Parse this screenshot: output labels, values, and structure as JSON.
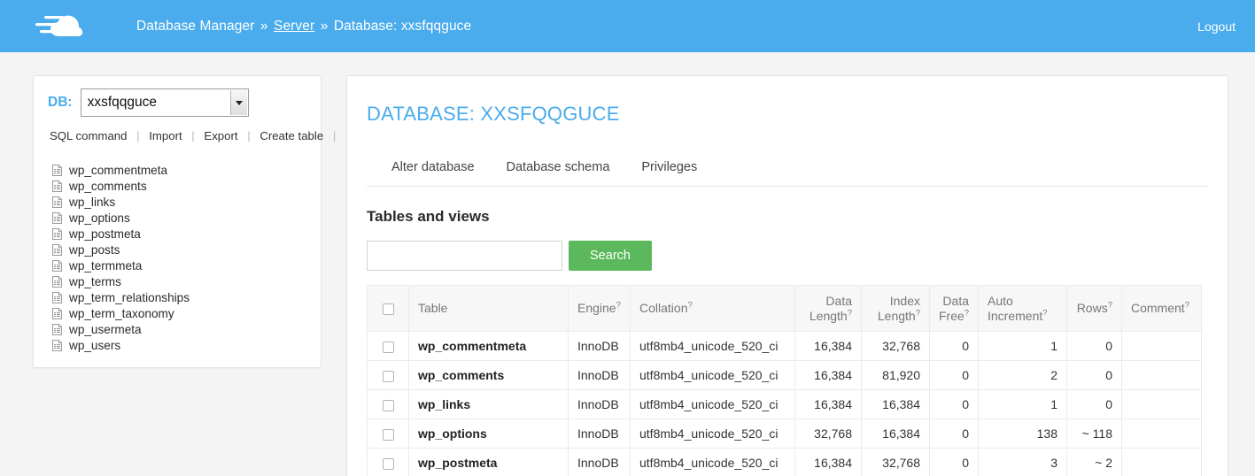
{
  "topbar": {
    "logo_icon": "cloud-speed-logo",
    "breadcrumb": {
      "root": "Database Manager",
      "sep1": "»",
      "server": "Server",
      "sep2": "»",
      "database": "Database: xxsfqqguce"
    },
    "logout_label": "Logout",
    "background_color": "#4aaced"
  },
  "sidebar": {
    "db_label": "DB:",
    "db_selected": "xxsfqqguce",
    "tools": [
      {
        "label": "SQL command"
      },
      {
        "label": "Import"
      },
      {
        "label": "Export"
      },
      {
        "label": "Create table"
      }
    ],
    "separator": "|",
    "tables": [
      {
        "name": "wp_commentmeta"
      },
      {
        "name": "wp_comments"
      },
      {
        "name": "wp_links"
      },
      {
        "name": "wp_options"
      },
      {
        "name": "wp_postmeta"
      },
      {
        "name": "wp_posts"
      },
      {
        "name": "wp_termmeta"
      },
      {
        "name": "wp_terms"
      },
      {
        "name": "wp_term_relationships"
      },
      {
        "name": "wp_term_taxonomy"
      },
      {
        "name": "wp_usermeta"
      },
      {
        "name": "wp_users"
      }
    ]
  },
  "main": {
    "title": "DATABASE: XXSFQQGUCE",
    "title_color": "#4aaced",
    "tabs": [
      {
        "label": "Alter database"
      },
      {
        "label": "Database schema"
      },
      {
        "label": "Privileges"
      }
    ],
    "section_title": "Tables and views",
    "search": {
      "value": "",
      "placeholder": "",
      "button_label": "Search",
      "button_color": "#5cb85c"
    },
    "table": {
      "help_marker": "?",
      "columns": [
        {
          "label": "Table",
          "help": false
        },
        {
          "label": "Engine",
          "help": true
        },
        {
          "label": "Collation",
          "help": true
        },
        {
          "label": "Data Length",
          "help": true
        },
        {
          "label": "Index Length",
          "help": true
        },
        {
          "label": "Data Free",
          "help": true
        },
        {
          "label": "Auto Increment",
          "help": true
        },
        {
          "label": "Rows",
          "help": true
        },
        {
          "label": "Comment",
          "help": true
        }
      ],
      "rows": [
        {
          "table": "wp_commentmeta",
          "engine": "InnoDB",
          "collation": "utf8mb4_unicode_520_ci",
          "data_length": "16,384",
          "index_length": "32,768",
          "data_free": "0",
          "auto_increment": "1",
          "rows": "0",
          "comment": ""
        },
        {
          "table": "wp_comments",
          "engine": "InnoDB",
          "collation": "utf8mb4_unicode_520_ci",
          "data_length": "16,384",
          "index_length": "81,920",
          "data_free": "0",
          "auto_increment": "2",
          "rows": "0",
          "comment": ""
        },
        {
          "table": "wp_links",
          "engine": "InnoDB",
          "collation": "utf8mb4_unicode_520_ci",
          "data_length": "16,384",
          "index_length": "16,384",
          "data_free": "0",
          "auto_increment": "1",
          "rows": "0",
          "comment": ""
        },
        {
          "table": "wp_options",
          "engine": "InnoDB",
          "collation": "utf8mb4_unicode_520_ci",
          "data_length": "32,768",
          "index_length": "16,384",
          "data_free": "0",
          "auto_increment": "138",
          "rows": "~ 118",
          "comment": ""
        },
        {
          "table": "wp_postmeta",
          "engine": "InnoDB",
          "collation": "utf8mb4_unicode_520_ci",
          "data_length": "16,384",
          "index_length": "32,768",
          "data_free": "0",
          "auto_increment": "3",
          "rows": "~ 2",
          "comment": ""
        }
      ]
    }
  }
}
